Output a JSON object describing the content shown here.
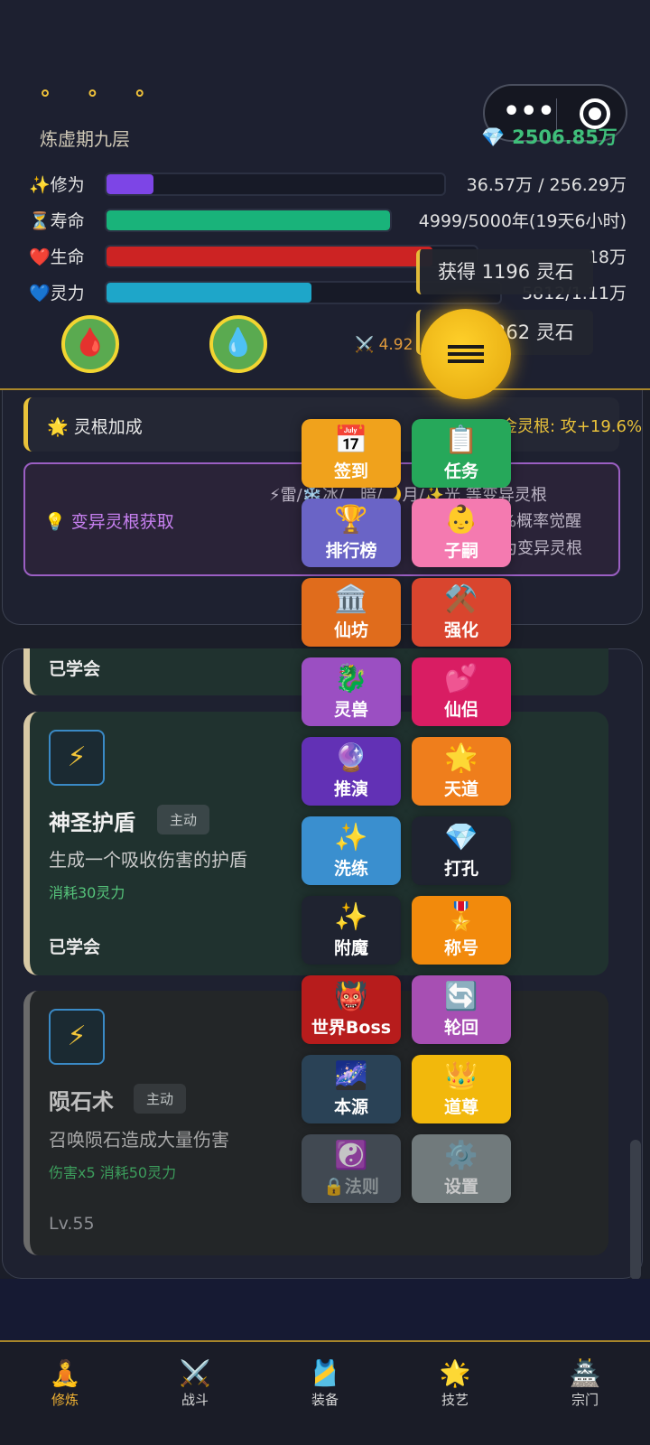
{
  "header": {
    "dots": "° ° °",
    "realm": "炼虚期九层",
    "spirit_stones": "2506.85万",
    "stats": [
      {
        "icon": "✨",
        "label": "修为",
        "value": "36.57万 / 256.29万",
        "fill_percent": 14,
        "color": "#7d45e6"
      },
      {
        "icon": "⏳",
        "label": "寿命",
        "value": "4999/5000年(19天6小时)",
        "fill_percent": 99.9,
        "color": "#19b37a"
      },
      {
        "icon": "❤️",
        "label": "生命",
        "value": "18万",
        "fill_percent": 88,
        "color": "#cc2323"
      },
      {
        "icon": "💙",
        "label": "灵力",
        "value": "5812/1.11万",
        "fill_percent": 52,
        "color": "#1ea6c9"
      }
    ],
    "potions": [
      "🩸",
      "💧"
    ],
    "attack": "4.92"
  },
  "toasts": [
    "获得 1196 灵石",
    "获得 1262 灵石"
  ],
  "bonus": {
    "icon": "🌟",
    "title": "灵根加成",
    "value": "金灵根: 攻+19.6%"
  },
  "mutation": {
    "icon": "💡",
    "title": "变异灵根获取",
    "lines": [
      "⚡雷/❄️冰/　暗/🌙月/✨光 等变异灵根",
      "%概率觉醒",
      "为变异灵根"
    ]
  },
  "skills": [
    {
      "status": "已学会"
    },
    {
      "icon": "⚡",
      "name": "神圣护盾",
      "tag": "主动",
      "desc": "生成一个吸收伤害的护盾",
      "cost": "消耗30灵力",
      "status": "已学会"
    },
    {
      "icon": "⚡",
      "name": "陨石术",
      "tag": "主动",
      "desc": "召唤陨石造成大量伤害",
      "cost": "伤害x5 消耗50灵力",
      "level": "Lv.55"
    }
  ],
  "menu": [
    {
      "icon": "📅",
      "label": "签到",
      "color": "#f0a21c"
    },
    {
      "icon": "📋",
      "label": "任务",
      "color": "#26a85a"
    },
    {
      "icon": "🏆",
      "label": "排行榜",
      "color": "#6a64c6"
    },
    {
      "icon": "👶",
      "label": "子嗣",
      "color": "#f47ab0"
    },
    {
      "icon": "🏛️",
      "label": "仙坊",
      "color": "#e06c1c"
    },
    {
      "icon": "⚒️",
      "label": "强化",
      "color": "#d9452e"
    },
    {
      "icon": "🐉",
      "label": "灵兽",
      "color": "#9b4fc2"
    },
    {
      "icon": "💕",
      "label": "仙侣",
      "color": "#d91d63"
    },
    {
      "icon": "🔮",
      "label": "推演",
      "color": "#6231b5"
    },
    {
      "icon": "🌟",
      "label": "天道",
      "color": "#ef7e1c"
    },
    {
      "icon": "✨",
      "label": "洗练",
      "color": "#3a8fcf"
    },
    {
      "icon": "💎",
      "label": "打孔",
      "color": "#1f2330"
    },
    {
      "icon": "✨",
      "label": "附魔",
      "color": "#1f2330"
    },
    {
      "icon": "🎖️",
      "label": "称号",
      "color": "#f28a0c"
    },
    {
      "icon": "👹",
      "label": "世界Boss",
      "color": "#b71c1c"
    },
    {
      "icon": "🔄",
      "label": "轮回",
      "color": "#a74fb3"
    },
    {
      "icon": "🌌",
      "label": "本源",
      "color": "#2a4256"
    },
    {
      "icon": "👑",
      "label": "道尊",
      "color": "#f2b80c"
    },
    {
      "icon": "☯️",
      "label": "🔒法则",
      "color": "#4b5560"
    },
    {
      "icon": "⚙️",
      "label": "设置",
      "color": "#8b9698"
    }
  ],
  "nav": [
    {
      "icon": "🧘",
      "label": "修炼",
      "active": true
    },
    {
      "icon": "⚔️",
      "label": "战斗",
      "active": false
    },
    {
      "icon": "🎽",
      "label": "装备",
      "active": false
    },
    {
      "icon": "🌟",
      "label": "技艺",
      "active": false
    },
    {
      "icon": "🏯",
      "label": "宗门",
      "active": false
    }
  ]
}
